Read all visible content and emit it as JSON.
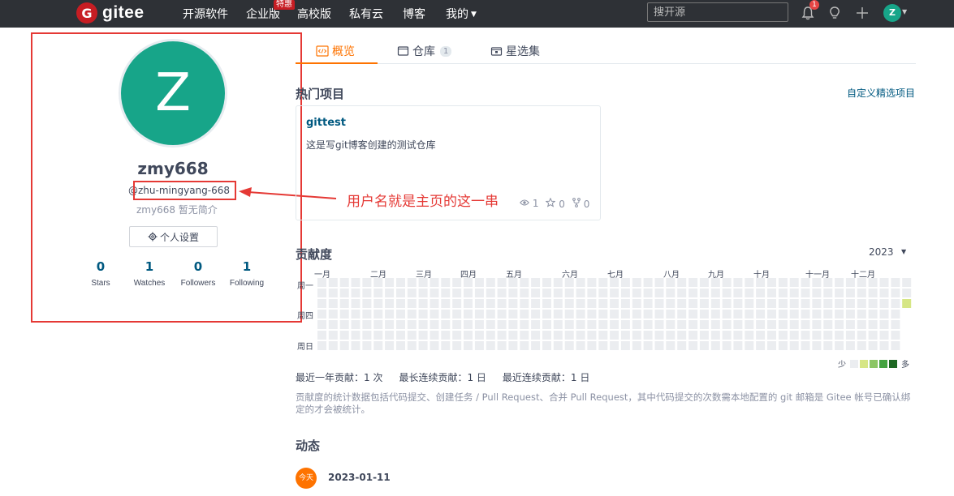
{
  "navbar": {
    "logo_letter": "G",
    "logo_text": "gitee",
    "items": [
      "开源软件",
      "企业版",
      "高校版",
      "私有云",
      "博客",
      "我的"
    ],
    "hot_badge": "特惠",
    "search_placeholder": "搜开源",
    "notification_count": "1",
    "avatar_letter": "Z"
  },
  "profile": {
    "avatar_letter": "Z",
    "username": "zmy668",
    "handle": "@zhu-mingyang-668",
    "bio": "zmy668 暂无简介",
    "settings_label": "个人设置",
    "stats": [
      {
        "num": "0",
        "label": "Stars"
      },
      {
        "num": "1",
        "label": "Watches"
      },
      {
        "num": "0",
        "label": "Followers"
      },
      {
        "num": "1",
        "label": "Following"
      }
    ]
  },
  "annotation": {
    "text": "用户名就是主页的这一串",
    "color": "#e53935"
  },
  "tabs": [
    {
      "label": "概览",
      "active": true
    },
    {
      "label": "仓库",
      "count": "1"
    },
    {
      "label": "星选集"
    }
  ],
  "hot_projects": {
    "title": "热门项目",
    "custom_link": "自定义精选项目",
    "project": {
      "name": "gittest",
      "description": "这是写git博客创建的测试仓库",
      "watches": "1",
      "stars": "0",
      "forks": "0"
    }
  },
  "contribution": {
    "title": "贡献度",
    "year": "2023",
    "months": [
      "一月",
      "二月",
      "三月",
      "四月",
      "五月",
      "六月",
      "七月",
      "八月",
      "九月",
      "十月",
      "十一月",
      "十二月"
    ],
    "day_labels": [
      "周一",
      "周四",
      "周日"
    ],
    "legend_less": "少",
    "legend_more": "多",
    "legend_colors": [
      "#ebedf0",
      "#d6e685",
      "#8cc665",
      "#44a340",
      "#1e6823"
    ],
    "summary": [
      "最近一年贡献：1 次",
      "最长连续贡献：1 日",
      "最近连续贡献：1 日"
    ],
    "note": "贡献度的统计数据包括代码提交、创建任务 / Pull Request、合并 Pull Request，其中代码提交的次数需本地配置的 git 邮箱是 Gitee 帐号已确认绑定的才会被统计。"
  },
  "activity": {
    "title": "动态",
    "today_badge": "今天",
    "date": "2023-01-11"
  },
  "colors": {
    "brand": "#c71d23",
    "accent": "#fe7300",
    "avatar": "#17a589",
    "link": "#005980"
  }
}
